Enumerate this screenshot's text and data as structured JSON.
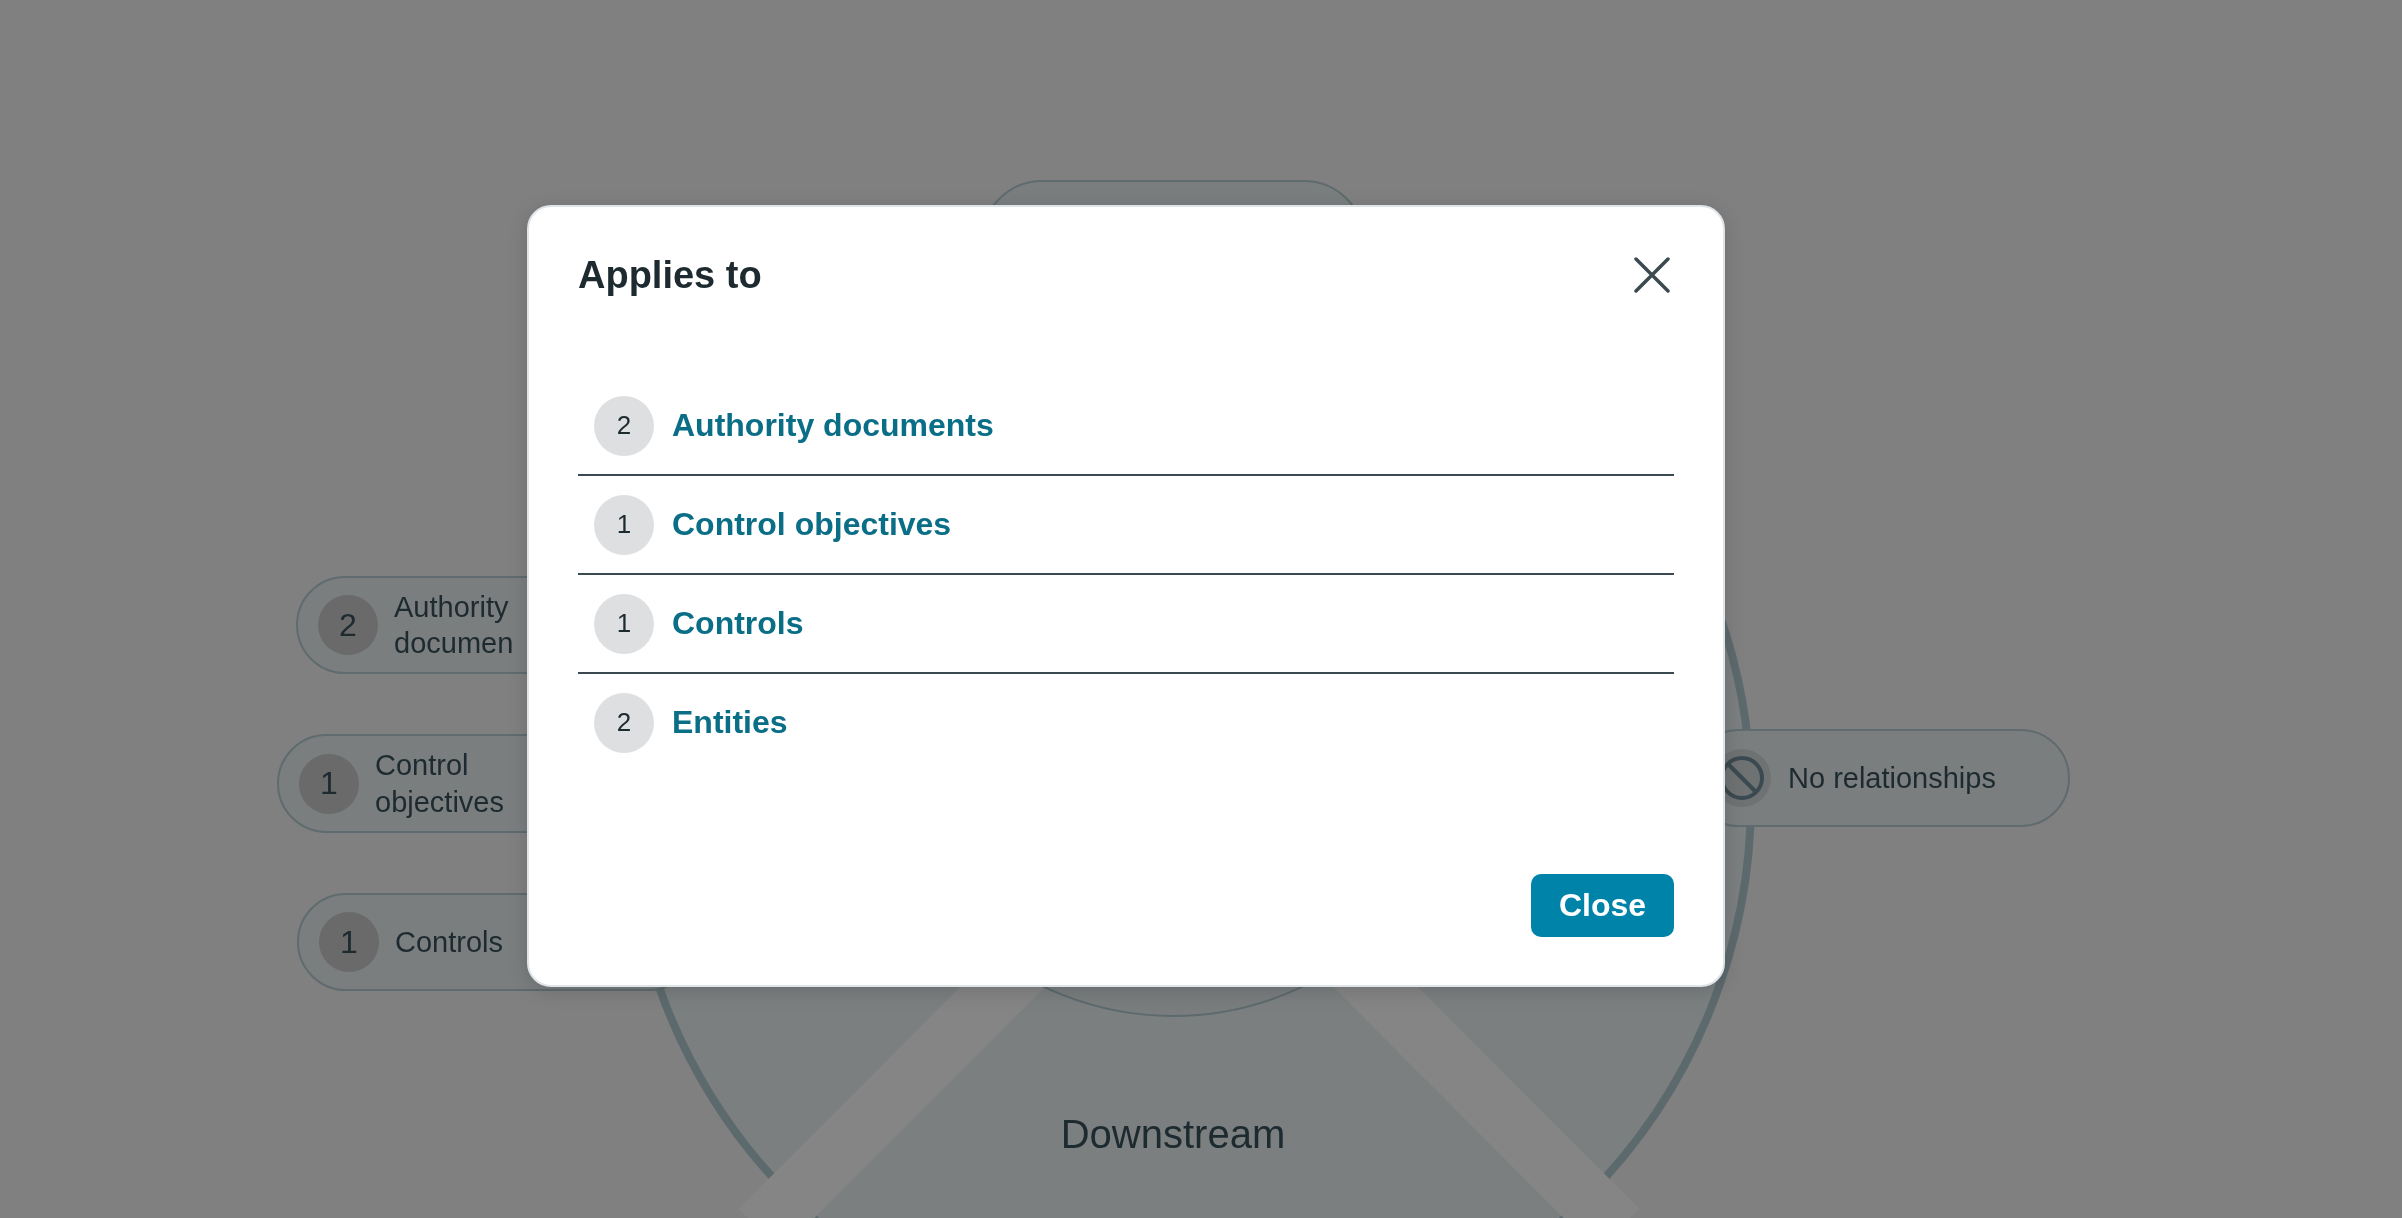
{
  "diagram": {
    "nodes": [
      {
        "kind": "count",
        "count": "2",
        "label": "Authority documen"
      },
      {
        "kind": "count",
        "count": "1",
        "label": "Control objectives"
      },
      {
        "kind": "count",
        "count": "1",
        "label": "Controls"
      },
      {
        "kind": "none",
        "label": "No relationships"
      }
    ],
    "section_label": "Downstream"
  },
  "modal": {
    "title": "Applies to",
    "items": [
      {
        "count": "2",
        "label": "Authority documents"
      },
      {
        "count": "1",
        "label": "Control objectives"
      },
      {
        "count": "1",
        "label": "Controls"
      },
      {
        "count": "2",
        "label": "Entities"
      }
    ],
    "close_button": "Close"
  }
}
